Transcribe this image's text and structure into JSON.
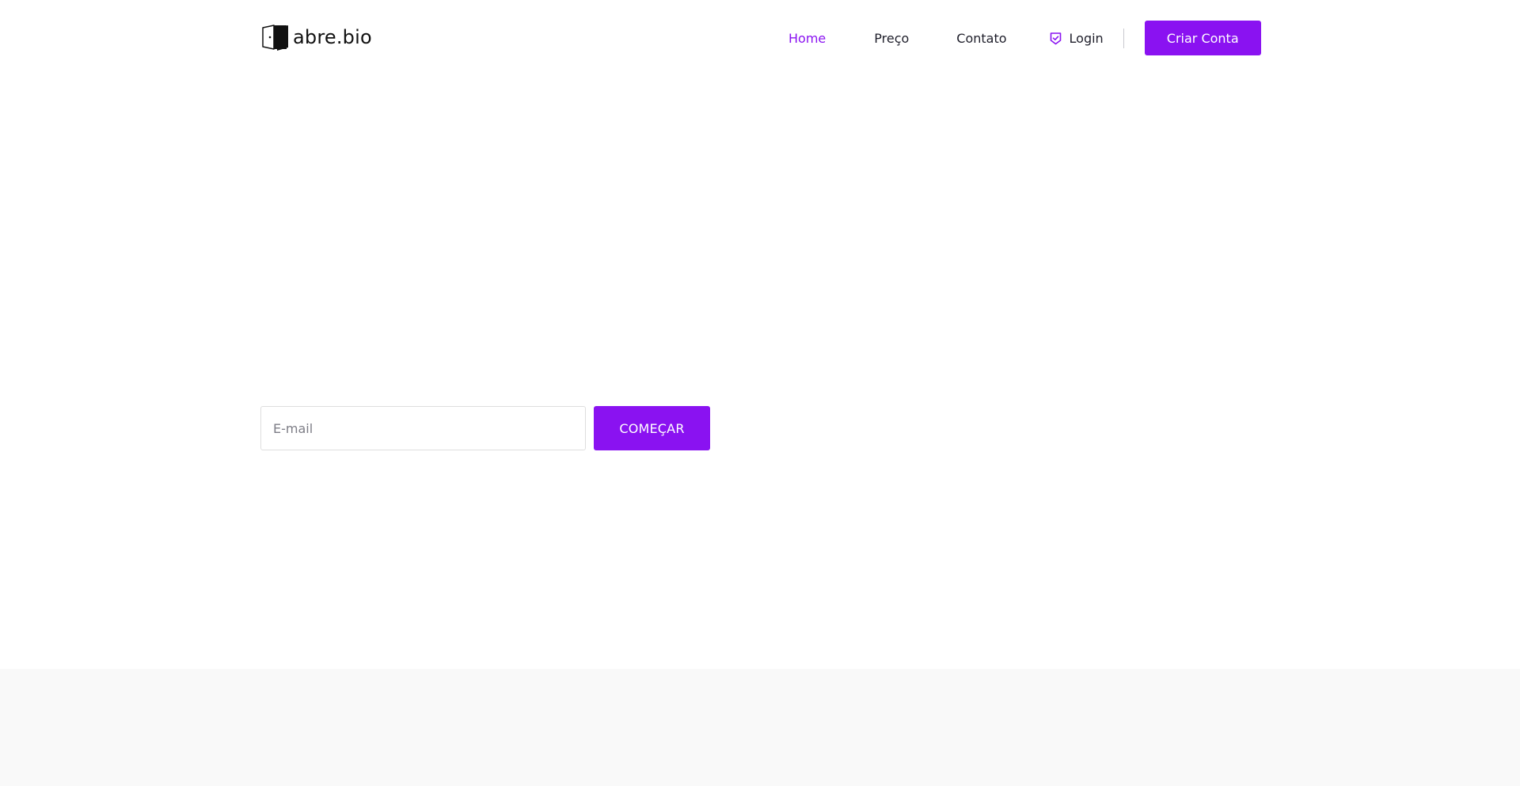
{
  "header": {
    "logo_text": "abre.bio",
    "nav": {
      "home": "Home",
      "preco": "Preço",
      "contato": "Contato",
      "login": "Login",
      "criar_conta": "Criar Conta"
    }
  },
  "signup": {
    "email_placeholder": "E-mail",
    "email_value": "",
    "start_label": "COMEÇAR"
  },
  "icons": {
    "logo": "door-logo-icon",
    "login": "shield-check-icon"
  },
  "colors": {
    "accent": "#8a12f1",
    "text": "#1e1e2a",
    "lower_background": "#f9f9f9"
  }
}
